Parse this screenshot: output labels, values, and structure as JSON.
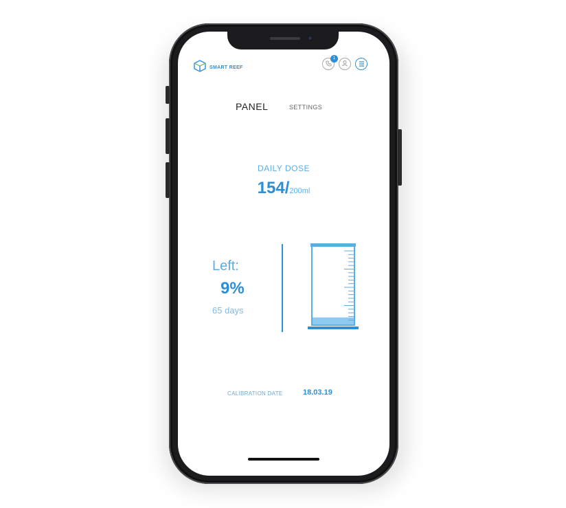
{
  "brand": {
    "name": "SMART REEF"
  },
  "header": {
    "badge_count": "1",
    "icons": [
      "phone-icon",
      "user-icon",
      "menu-icon"
    ]
  },
  "tabs": [
    {
      "label": "PANEL",
      "active": true
    },
    {
      "label": "SETTINGS",
      "active": false
    }
  ],
  "dose": {
    "label": "DAILY DOSE",
    "current": "154/",
    "total": "200ml"
  },
  "remaining": {
    "label": "Left:",
    "percent": "9%",
    "percent_value": 9,
    "days": "65 days"
  },
  "calibration": {
    "label": "CALIBRATION DATE",
    "date": "18.03.19"
  },
  "colors": {
    "accent": "#2e8fd6",
    "accent_light": "#5aaee6",
    "text_dark": "#222222",
    "phone_frame": "#1c1c1e"
  }
}
